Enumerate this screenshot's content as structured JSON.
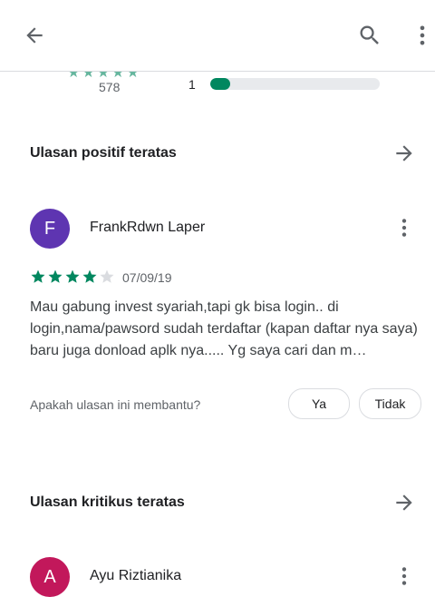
{
  "appbar": {
    "back_icon": "arrow-back-icon",
    "search_icon": "search-icon",
    "more_icon": "more-vert-icon"
  },
  "ratings_peek": {
    "total_reviews": "578",
    "bar_label": "1",
    "bar_fraction": 0.12,
    "bar_color": "#01875f"
  },
  "positive_section": {
    "title": "Ulasan positif teratas",
    "arrow_icon": "arrow-forward-icon"
  },
  "review": {
    "avatar_letter": "F",
    "avatar_color": "#5e35b1",
    "author": "FrankRdwn Laper",
    "rating": 4,
    "max_rating": 5,
    "date": "07/09/19",
    "text": "Mau gabung invest syariah,tapi gk bisa login.. di login,nama/pawsord sudah terdaftar (kapan daftar nya saya) baru juga donload aplk nya..... Yg saya cari dan m…",
    "helpful_prompt": "Apakah ulasan ini membantu?",
    "yes_label": "Ya",
    "no_label": "Tidak"
  },
  "critical_section": {
    "title": "Ulasan kritikus teratas",
    "arrow_icon": "arrow-forward-icon"
  },
  "next_review": {
    "avatar_letter": "A",
    "avatar_color": "#c2185b",
    "author": "Ayu Riztianika"
  }
}
